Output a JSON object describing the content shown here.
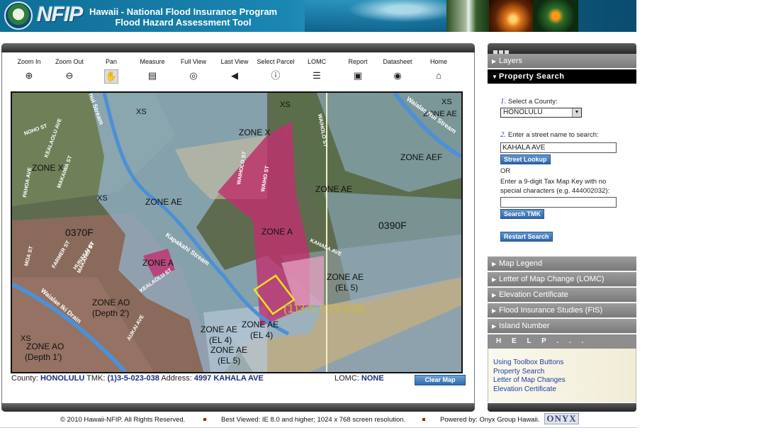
{
  "header": {
    "logo_text": "NFIP",
    "title_line1": "Hawaii - National Flood Insurance Program",
    "title_line2": "Flood Hazard Assessment Tool"
  },
  "toolbar": [
    {
      "label": "Zoom In",
      "icon": "zoom-in-icon",
      "glyph": "⊕"
    },
    {
      "label": "Zoom Out",
      "icon": "zoom-out-icon",
      "glyph": "⊖"
    },
    {
      "label": "Pan",
      "icon": "hand-icon",
      "glyph": "✋",
      "active": true
    },
    {
      "label": "Measure",
      "icon": "ruler-icon",
      "glyph": "▤"
    },
    {
      "label": "Full View",
      "icon": "globe-magnifier-icon",
      "glyph": "◎"
    },
    {
      "label": "Last View",
      "icon": "back-arrow-icon",
      "glyph": "◀"
    },
    {
      "label": "Select Parcel",
      "icon": "info-icon",
      "glyph": "ⓘ"
    },
    {
      "label": "LOMC",
      "icon": "list-icon",
      "glyph": "☰"
    },
    {
      "label": "Report",
      "icon": "report-icon",
      "glyph": "▣"
    },
    {
      "label": "Datasheet",
      "icon": "datasheet-icon",
      "glyph": "◉"
    },
    {
      "label": "Home",
      "icon": "home-icon",
      "glyph": "⌂"
    }
  ],
  "map": {
    "labels": {
      "xs_top_left": "XS",
      "xs_top_center": "XS",
      "xs_top_right": "XS",
      "xs_left": "XS",
      "xs_bottom_left": "XS",
      "zone_x_center": "ZONE X",
      "zone_x_left": "ZONE X",
      "zone_ae_left": "ZONE AE",
      "zone_ae_center": "ZONE AE",
      "zone_aef_right": "ZONE AEF",
      "zone_ae_top_right": "ZONE AE",
      "panel_left": "0370F",
      "panel_right": "0390F",
      "zone_a_center": "ZONE A",
      "zone_a_left": "ZONE A",
      "zone_ae_el5_right": "ZONE AE",
      "zone_ae_el5_right_sub": "(EL 5)",
      "zone_ao_depth2": "ZONE AO",
      "zone_ao_depth2_sub": "(Depth 2')",
      "zone_ao_depth1": "ZONE AO",
      "zone_ao_depth1_sub": "(Depth 1')",
      "zone_ae_el4_a": "ZONE AE",
      "zone_ae_el4_a_sub": "(EL 4)",
      "zone_ae_el4_b": "ZONE AE",
      "zone_ae_el4_b_sub": "(EL 4)",
      "zone_ae_el5_bottom": "ZONE AE",
      "zone_ae_el5_bottom_sub": "(EL 5)",
      "parcel_id": "(1)3-5-023-038",
      "street_kealaolu_ave": "KEALAOLU AVE",
      "street_noho_st": "NOHO ST",
      "street_makaiwa_st": "MAKAIWA ST",
      "street_pahoa_ave": "PAHOA AVE",
      "street_waiholo_st": "WAIHOLO ST",
      "street_waiholo_st2": "WAIHOLO ST",
      "street_waiho_st": "WAIHO ST",
      "street_kahala_ave": "KAHALA AVE",
      "street_moa_st": "MOA ST",
      "street_farmer": "FARMER ST",
      "street_hunakai": "HUNAKAI ST",
      "street_makahiu": "MAKAHIU ST",
      "street_kealaolu_st": "KEALAOLU ST",
      "street_aukai_ave": "AUKAI AVE",
      "stream_top": "nui Stream",
      "stream_waialae": "Waialae Nui Stream",
      "stream_kapakahi": "Kapakahi Stream",
      "canal_waialae": "Waialae Iki Drain"
    }
  },
  "status": {
    "county_label": "County:",
    "county_value": "HONOLULU",
    "tmk_label": "TMK:",
    "tmk_value": "(1)3-5-023-038",
    "address_label": "Address:",
    "address_value": "4997 KAHALA AVE",
    "lomc_label": "LOMC:",
    "lomc_value": "NONE",
    "clear_map": "Clear Map"
  },
  "sidebar": {
    "layers": "Layers",
    "property_search": "Property Search",
    "step1_num": "1.",
    "step1_text": "Select a County:",
    "county_selected": "HONOLULU",
    "step2_num": "2.",
    "step2_text": "Enter a street name to search:",
    "street_value": "KAHALA AVE",
    "street_lookup": "Street Lookup",
    "or_text": "OR",
    "tmk_text_line1": "Enter a 9-digit Tax Map Key with no",
    "tmk_text_line2": "special characters (e.g. 444002032):",
    "tmk_value": "",
    "search_tmk": "Search TMK",
    "restart_search": "Restart Search",
    "sections": [
      "Map Legend",
      "Letter of Map Change (LOMC)",
      "Elevation Certificate",
      "Flood Insurance Studies (FIS)",
      "Island Number"
    ],
    "help_title": "H E L P . . .",
    "help_links": [
      "Using Toolbox Buttons",
      "Property Search",
      "Letter of Map Changes",
      "Elevation Certificate"
    ]
  },
  "footer": {
    "copyright": "© 2010  Hawaii-NFIP.  All Rights Reserved.",
    "best_viewed": "Best Viewed: IE 8.0 and higher; 1024 x 768 screen resolution.",
    "powered_by": "Powered by: Onyx Group Hawaii.",
    "onyx_logo": "ONYX"
  },
  "colors": {
    "accent_blue": "#1a2f7a",
    "zone_pink": "#c0306f",
    "zone_blue": "#8fb0c8",
    "parcel_outline": "#f2e021"
  }
}
